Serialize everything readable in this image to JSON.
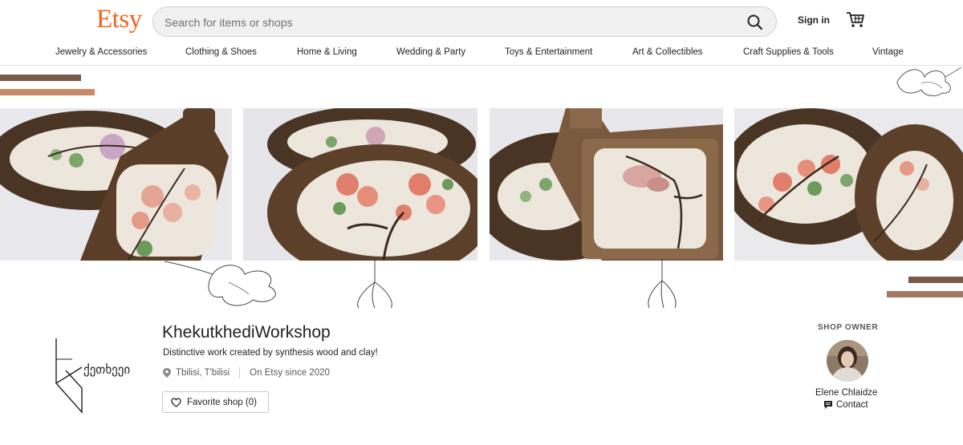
{
  "header": {
    "logo": "Etsy",
    "search_placeholder": "Search for items or shops",
    "signin_label": "Sign in"
  },
  "nav": {
    "items": [
      "Jewelry & Accessories",
      "Clothing & Shoes",
      "Home & Living",
      "Wedding & Party",
      "Toys & Entertainment",
      "Art & Collectibles",
      "Craft Supplies & Tools",
      "Vintage"
    ]
  },
  "banner": {
    "photos": [
      "cutting-boards-blossom-1",
      "cutting-boards-blossom-2",
      "cutting-boards-magnolia",
      "cutting-boards-blossom-3"
    ],
    "stripe_colors": [
      "#7a5a4a",
      "#c98a68"
    ]
  },
  "shop": {
    "logo_text": "ქეთხეეი",
    "name": "KhekutkhediWorkshop",
    "tagline": "Distinctive work created by synthesis wood and clay!",
    "location": "Tbilisi, T'bilisi",
    "since": "On Etsy since 2020",
    "favorite_label": "Favorite shop (0)"
  },
  "owner": {
    "title": "SHOP OWNER",
    "name": "Elene Chlaidze",
    "contact_label": "Contact"
  },
  "colors": {
    "brand": "#F1641E",
    "wood_dark": "#4a3524",
    "ceramic": "#ece6dc",
    "blossom": "#e48a78"
  }
}
